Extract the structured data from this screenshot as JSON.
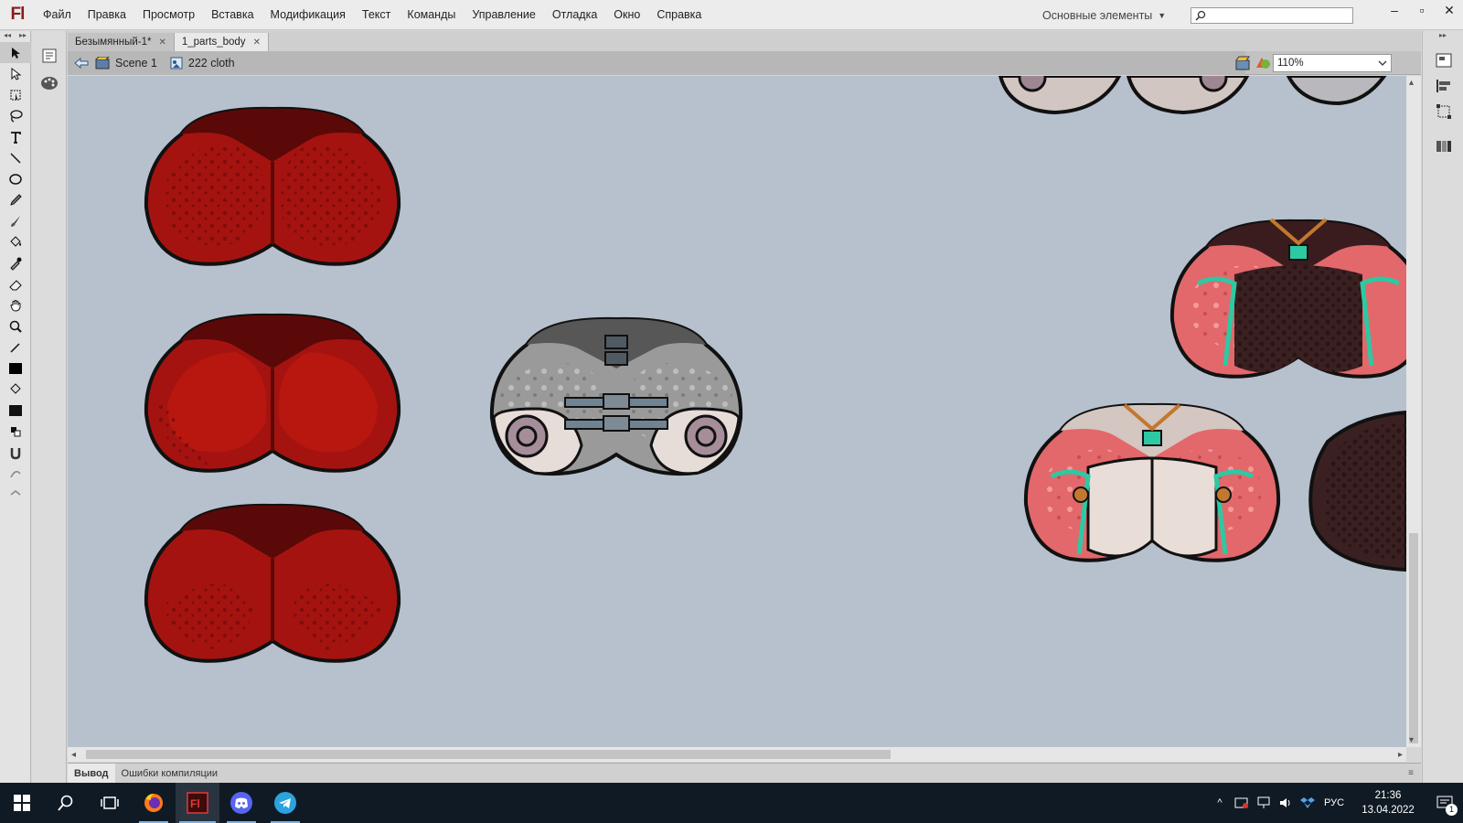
{
  "app": {
    "logo": "Fl",
    "menu": [
      "Файл",
      "Правка",
      "Просмотр",
      "Вставка",
      "Модификация",
      "Текст",
      "Команды",
      "Управление",
      "Отладка",
      "Окно",
      "Справка"
    ],
    "workspace_label": "Основные элементы",
    "search_placeholder": ""
  },
  "window_controls": {
    "minimize_icon": "minimize-icon",
    "maximize_icon": "maximize-icon",
    "close_icon": "close-icon"
  },
  "document_tabs": [
    {
      "label": "Безымянный-1*",
      "active": false
    },
    {
      "label": "1_parts_body",
      "active": true
    }
  ],
  "edit_bar": {
    "scene_label": "Scene 1",
    "symbol_label": "222 cloth",
    "zoom": "110%"
  },
  "tools": [
    "selection-tool",
    "subselection-tool",
    "free-transform-tool",
    "lasso-tool",
    "text-tool",
    "line-tool",
    "oval-tool",
    "pencil-tool",
    "brush-tool",
    "paint-bucket-tool",
    "eyedropper-tool",
    "eraser-tool",
    "hand-tool",
    "zoom-tool",
    "stroke-color",
    "fill-color",
    "swap-colors",
    "snap-tool"
  ],
  "stage": {
    "background_color": "#b7c1cd",
    "objects": [
      {
        "name": "red-sprite-1",
        "color": "#a51310"
      },
      {
        "name": "red-sprite-2",
        "color": "#a51310"
      },
      {
        "name": "red-sprite-3",
        "color": "#a51310"
      },
      {
        "name": "gray-armor-sprite",
        "color": "#9a9a9a"
      },
      {
        "name": "pink-armor-sprite-top",
        "color": "#e2686b"
      },
      {
        "name": "pink-armor-sprite-bottom",
        "color": "#e2686b"
      },
      {
        "name": "dark-sprite-partial",
        "color": "#3b2022"
      }
    ]
  },
  "output_tabs": [
    {
      "label": "Вывод",
      "active": true
    },
    {
      "label": "Ошибки компиляции",
      "active": false
    }
  ],
  "taskbar": {
    "apps": [
      "windows-start",
      "search",
      "task-view",
      "firefox",
      "flash",
      "discord",
      "telegram"
    ],
    "language": "РУС",
    "time": "21:36",
    "date": "13.04.2022",
    "notification_count": "1"
  }
}
